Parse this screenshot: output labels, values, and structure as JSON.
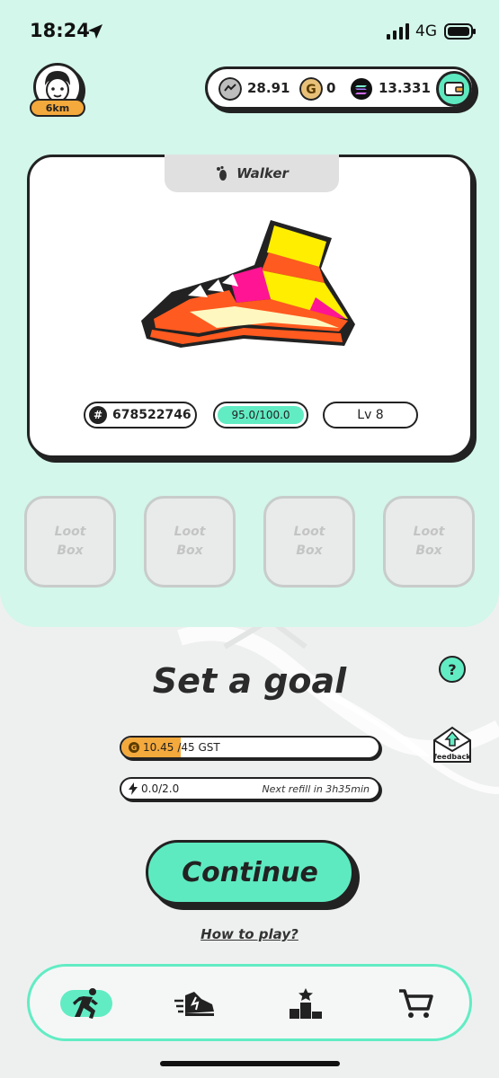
{
  "status_bar": {
    "time": "18:24",
    "network": "4G"
  },
  "profile": {
    "distance_badge": "6km"
  },
  "balances": [
    {
      "icon": "gmt-token-icon",
      "value": "28.91"
    },
    {
      "icon": "gst-token-icon",
      "value": "0"
    },
    {
      "icon": "solana-token-icon",
      "value": "13.331"
    }
  ],
  "sneaker": {
    "class_label": "Walker",
    "id": "678522746",
    "durability": "95.0/100.0",
    "durability_fraction": 0.95,
    "level": "Lv 8",
    "colors": {
      "primary": "#ff5a1f",
      "accent": "#ff1493",
      "highlight": "#ffee00"
    }
  },
  "lootboxes": [
    {
      "label": "Loot\nBox"
    },
    {
      "label": "Loot\nBox"
    },
    {
      "label": "Loot\nBox"
    },
    {
      "label": "Loot\nBox"
    }
  ],
  "goal": {
    "title": "Set a goal",
    "gst_earned": "10.45",
    "gst_cap": "/45 GST",
    "gst_fraction": 0.232,
    "energy": "0.0/2.0",
    "refill_text": "Next refill in 3h35min"
  },
  "actions": {
    "continue_label": "Continue",
    "how_to_play": "How to play?",
    "help": "?",
    "feedback": "feedback"
  },
  "tabs": [
    {
      "icon": "run-icon",
      "active": true
    },
    {
      "icon": "sneaker-icon",
      "active": false
    },
    {
      "icon": "leaderboard-icon",
      "active": false
    },
    {
      "icon": "cart-icon",
      "active": false
    }
  ],
  "theme": {
    "mint": "#62ecc4",
    "panel": "#d3f7ea",
    "orange": "#f4a93c",
    "ink": "#222222"
  }
}
